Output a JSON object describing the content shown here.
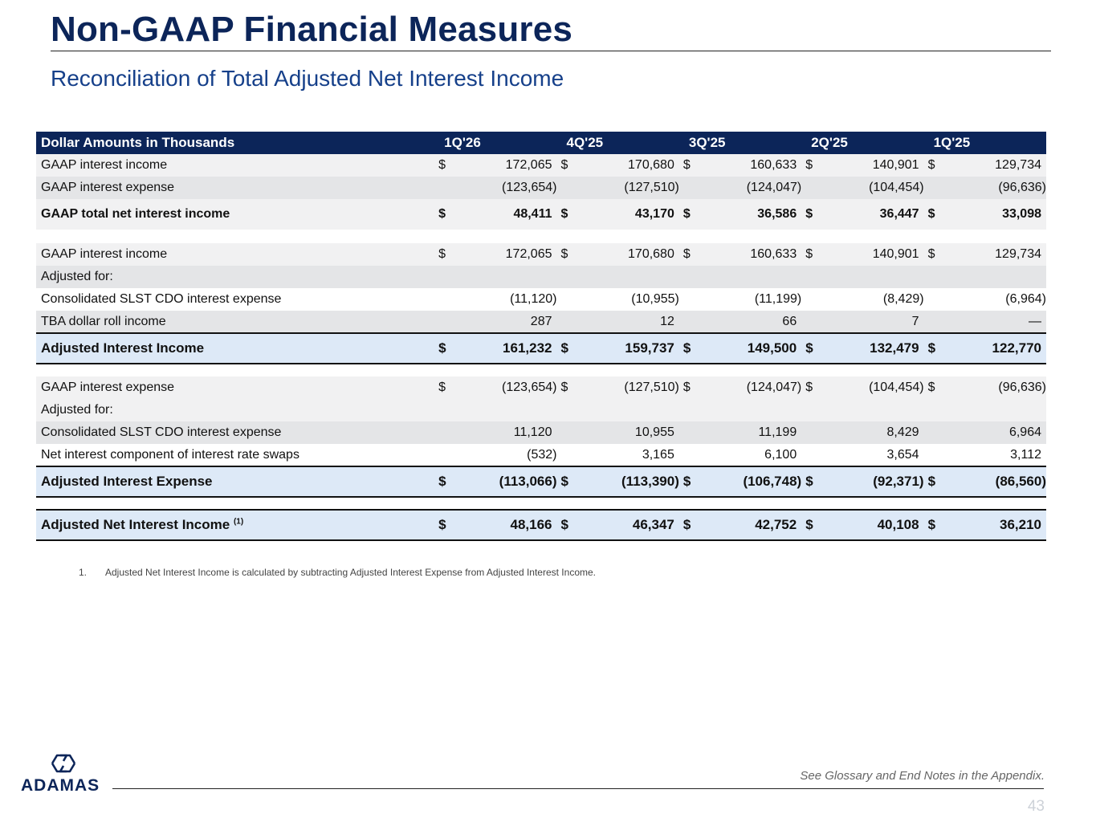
{
  "header": {
    "title": "Non-GAAP Financial Measures",
    "subtitle": "Reconciliation of Total Adjusted Net Interest Income"
  },
  "table": {
    "label_header": "Dollar Amounts in Thousands",
    "periods": [
      "1Q'26",
      "4Q'25",
      "3Q'25",
      "2Q'25",
      "1Q'25"
    ],
    "rows": {
      "gaap_ii": {
        "label": "GAAP interest income",
        "cur": "$",
        "vals": [
          "172,065",
          "170,680",
          "160,633",
          "140,901",
          "129,734"
        ]
      },
      "gaap_ie": {
        "label": "GAAP interest expense",
        "cur": "",
        "vals": [
          "(123,654)",
          "(127,510)",
          "(124,047)",
          "(104,454)",
          "(96,636)"
        ]
      },
      "gaap_nii": {
        "label": "GAAP total net interest income",
        "cur": "$",
        "vals": [
          "48,411",
          "43,170",
          "36,586",
          "36,447",
          "33,098"
        ]
      },
      "gaap_ii2": {
        "label": "GAAP interest income",
        "cur": "$",
        "vals": [
          "172,065",
          "170,680",
          "160,633",
          "140,901",
          "129,734"
        ]
      },
      "adj1": {
        "label": "Adjusted for:"
      },
      "slst1": {
        "label": "Consolidated SLST CDO interest expense",
        "cur": "",
        "vals": [
          "(11,120)",
          "(10,955)",
          "(11,199)",
          "(8,429)",
          "(6,964)"
        ]
      },
      "tba": {
        "label": "TBA dollar roll income",
        "cur": "",
        "vals": [
          "287",
          "12",
          "66",
          "7",
          "—"
        ]
      },
      "adj_ii": {
        "label": "Adjusted Interest Income",
        "cur": "$",
        "vals": [
          "161,232",
          "159,737",
          "149,500",
          "132,479",
          "122,770"
        ]
      },
      "gaap_ie2": {
        "label": "GAAP interest expense",
        "cur": "$",
        "vals": [
          "(123,654)",
          "(127,510)",
          "(124,047)",
          "(104,454)",
          "(96,636)"
        ]
      },
      "adj2": {
        "label": "Adjusted for:"
      },
      "slst2": {
        "label": "Consolidated SLST CDO interest expense",
        "cur": "",
        "vals": [
          "11,120",
          "10,955",
          "11,199",
          "8,429",
          "6,964"
        ]
      },
      "swaps": {
        "label": "Net interest component of interest rate swaps",
        "cur": "",
        "vals": [
          "(532)",
          "3,165",
          "6,100",
          "3,654",
          "3,112"
        ]
      },
      "adj_ie": {
        "label": "Adjusted Interest Expense",
        "cur": "$",
        "vals": [
          "(113,066)",
          "(113,390)",
          "(106,748)",
          "(92,371)",
          "(86,560)"
        ]
      },
      "adj_nii": {
        "label": "Adjusted Net Interest Income",
        "sup": "(1)",
        "cur": "$",
        "vals": [
          "48,166",
          "46,347",
          "42,752",
          "40,108",
          "36,210"
        ]
      }
    }
  },
  "footnote": {
    "number": "1.",
    "text": "Adjusted Net Interest Income is calculated by subtracting Adjusted Interest Expense from Adjusted Interest Income."
  },
  "footer": {
    "logo_text": "ADAMAS",
    "logo_icon": "interlocking-hexagon-logo-icon",
    "note": "See Glossary and End Notes in the Appendix.",
    "page_number": "43"
  },
  "colors": {
    "navy": "#0c2559",
    "subtitle_blue": "#16408a",
    "total_row_blue": "#dde9f7",
    "row_shade": "#e4e5e7"
  }
}
